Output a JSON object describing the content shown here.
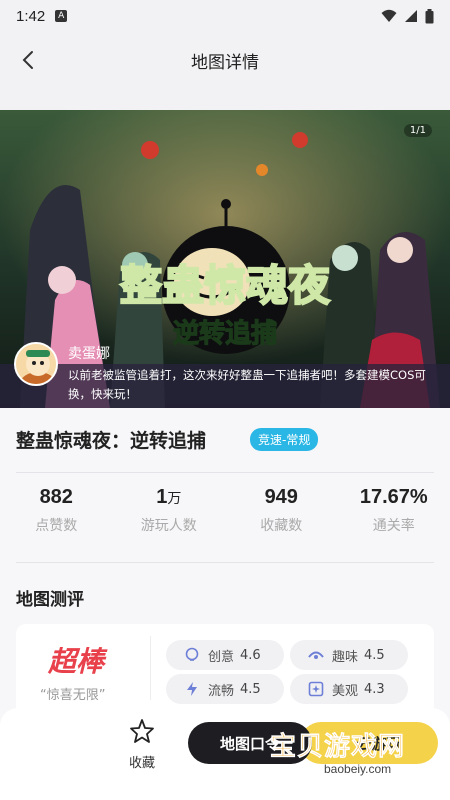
{
  "status_bar": {
    "time": "1:42",
    "notification_icon": "a-icon",
    "icons": [
      "wifi-icon",
      "signal-icon",
      "battery-icon"
    ]
  },
  "header": {
    "title": "地图详情",
    "back_icon": "chevron-left-icon"
  },
  "banner": {
    "counter": "1/1",
    "artwork_title": "整蛊惊魂夜",
    "artwork_subtitle": "逆转追捕",
    "author": {
      "name": "卖蛋娜"
    },
    "description": "以前老被监管追着打，这次来好好整蛊一下追捕者吧！多套建模COS可换，快来玩！"
  },
  "map": {
    "title": "整蛊惊魂夜：逆转追捕",
    "tag": "竞速-常规",
    "tag_color": "#2bb7e6"
  },
  "stats": [
    {
      "value": "882",
      "unit": "",
      "label": "点赞数"
    },
    {
      "value": "1",
      "unit": "万",
      "label": "游玩人数"
    },
    {
      "value": "949",
      "unit": "",
      "label": "收藏数"
    },
    {
      "value": "17.67%",
      "unit": "",
      "label": "通关率"
    }
  ],
  "review": {
    "section_title": "地图测评",
    "rating_word": "超棒",
    "rating_quote": "“惊喜无限”",
    "accent_color": "#e8414b",
    "metrics": [
      {
        "label": "创意",
        "value": "4.6",
        "icon": "lightbulb-icon"
      },
      {
        "label": "趣味",
        "value": "4.5",
        "icon": "gamepad-icon"
      },
      {
        "label": "流畅",
        "value": "4.5",
        "icon": "lightning-icon"
      },
      {
        "label": "美观",
        "value": "4.3",
        "icon": "sparkle-icon"
      }
    ]
  },
  "bottom_bar": {
    "favorite_label": "收藏",
    "map_code_button": "地图口令",
    "play_button": "云游玩",
    "play_color": "#f4d24a"
  },
  "watermark": {
    "text": "宝贝游戏网",
    "url": "baobeiy.com"
  }
}
